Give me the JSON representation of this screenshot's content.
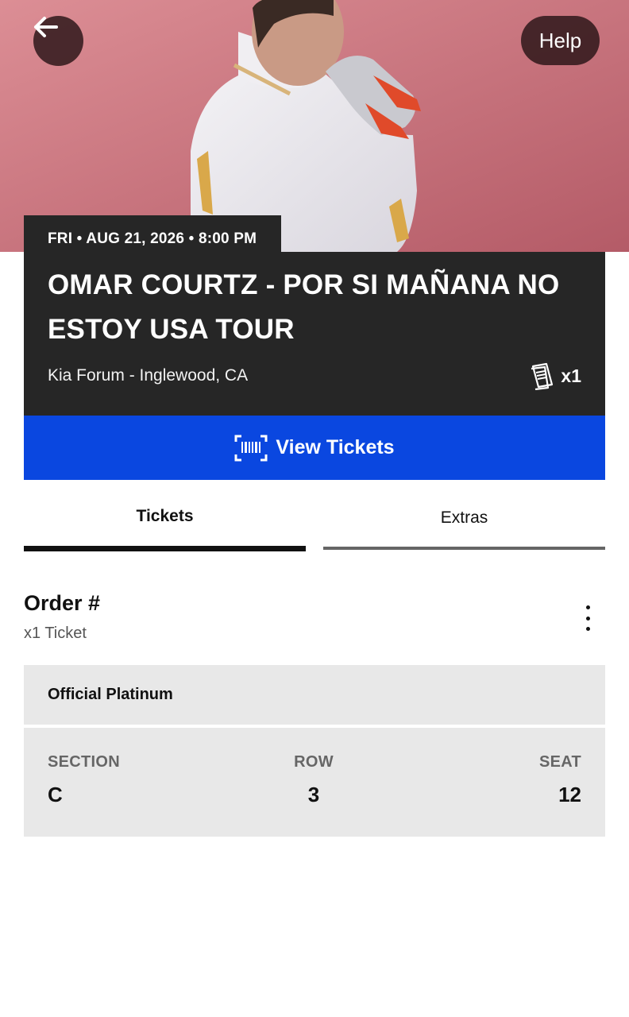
{
  "hero": {
    "back_icon": "arrow-left-icon",
    "help_label": "Help"
  },
  "event": {
    "date_time": "FRI • AUG 21, 2026 • 8:00 PM",
    "title": "OMAR COURTZ - POR SI MAÑANA NO ESTOY USA TOUR",
    "venue": "Kia Forum - Inglewood, CA",
    "ticket_count": "x1",
    "ticket_count_icon": "tickets-icon"
  },
  "actions": {
    "view_tickets_label": "View Tickets",
    "view_tickets_icon": "barcode-scan-icon"
  },
  "tabs": [
    {
      "label": "Tickets",
      "active": true
    },
    {
      "label": "Extras",
      "active": false
    }
  ],
  "order": {
    "title": "Order #",
    "subtitle": "x1 Ticket"
  },
  "ticket": {
    "tier": "Official Platinum",
    "section_label": "SECTION",
    "section_value": "C",
    "row_label": "ROW",
    "row_value": "3",
    "seat_label": "SEAT",
    "seat_value": "12"
  },
  "colors": {
    "accent_blue": "#0a47e0",
    "card_dark": "#262626",
    "panel_gray": "#e8e8e8"
  }
}
